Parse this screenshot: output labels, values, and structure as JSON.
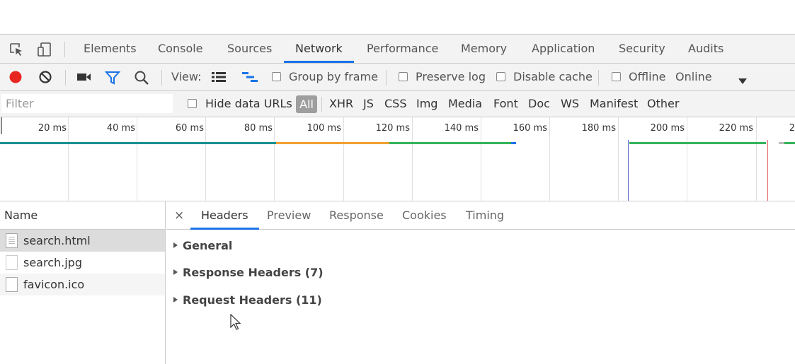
{
  "tabs": [
    {
      "label": "Elements"
    },
    {
      "label": "Console"
    },
    {
      "label": "Sources"
    },
    {
      "label": "Network"
    },
    {
      "label": "Performance"
    },
    {
      "label": "Memory"
    },
    {
      "label": "Application"
    },
    {
      "label": "Security"
    },
    {
      "label": "Audits"
    }
  ],
  "active_tab": "Network",
  "toolbar": {
    "view_label": "View:",
    "group_by_frame": "Group by frame",
    "preserve_log": "Preserve log",
    "disable_cache": "Disable cache",
    "offline": "Offline",
    "throttle_value": "Online",
    "record_icon": "record-icon",
    "clear_icon": "clear-icon",
    "capture_icon": "video-camera-icon",
    "filter_icon": "filter-icon",
    "search_icon": "search-icon",
    "colors": {
      "record": "#e8261f",
      "accent": "#1a73e8"
    }
  },
  "filterbar": {
    "placeholder": "Filter",
    "hide_data_urls": "Hide data URLs",
    "types": [
      "All",
      "XHR",
      "JS",
      "CSS",
      "Img",
      "Media",
      "Font",
      "Doc",
      "WS",
      "Manifest",
      "Other"
    ]
  },
  "overview": {
    "ticks": [
      "20 ms",
      "40 ms",
      "60 ms",
      "80 ms",
      "100 ms",
      "120 ms",
      "140 ms",
      "160 ms",
      "180 ms",
      "200 ms",
      "220 ms",
      "2"
    ]
  },
  "requests": {
    "header": "Name",
    "items": [
      {
        "name": "search.html"
      },
      {
        "name": "search.jpg"
      },
      {
        "name": "favicon.ico"
      }
    ]
  },
  "details": {
    "close": "×",
    "tabs": [
      "Headers",
      "Preview",
      "Response",
      "Cookies",
      "Timing"
    ],
    "active_tab": "Headers",
    "sections": [
      "General",
      "Response Headers (7)",
      "Request Headers (11)"
    ]
  }
}
